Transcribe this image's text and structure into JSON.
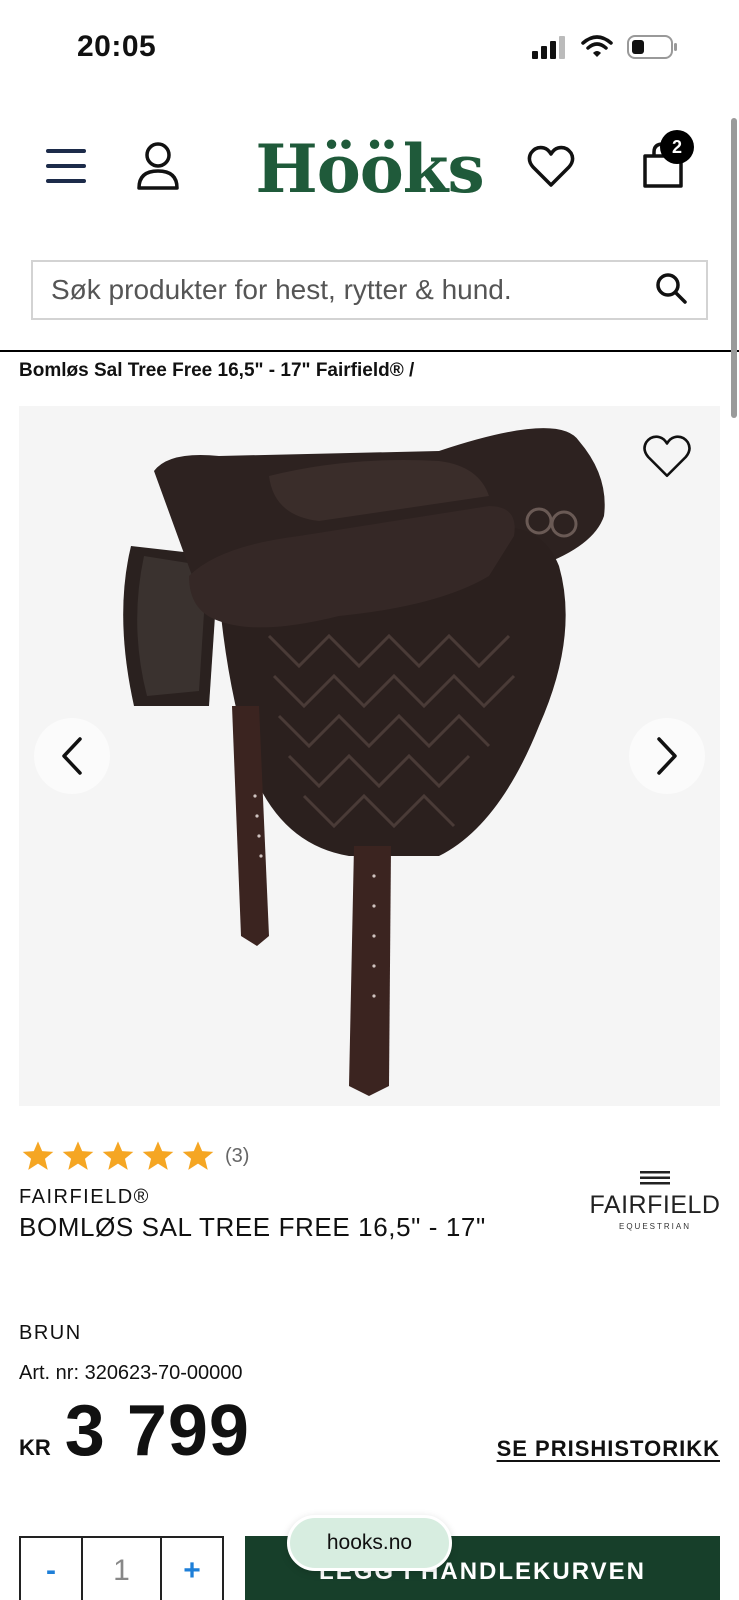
{
  "status_bar": {
    "time": "20:05"
  },
  "header": {
    "logo": "Hööks",
    "cart_count": "2"
  },
  "search": {
    "placeholder": "Søk produkter for hest, rytter & hund."
  },
  "breadcrumb": "Bomløs Sal Tree Free 16,5\" - 17\" Fairfield® /",
  "product": {
    "rating": {
      "stars": 5,
      "count": "(3)"
    },
    "brand": "FAIRFIELD®",
    "title": "BOMLØS SAL TREE FREE 16,5\" - 17\"",
    "brand_logo": {
      "name": "FAIRFIELD",
      "sub": "EQUESTRIAN"
    },
    "color": "BRUN",
    "art_nr": "Art. nr: 320623-70-00000",
    "currency": "KR",
    "price": "3 799",
    "price_history_link": "SE PRISHISTORIKK"
  },
  "cart_controls": {
    "minus": "-",
    "quantity": "1",
    "plus": "+",
    "add_to_cart": "LEGG I HANDLEKURVEN"
  },
  "browser": {
    "site": "hooks.no"
  },
  "colors": {
    "brand_green": "#1f5a3a",
    "button_green": "#173f2a",
    "star": "#f5a623",
    "qty_blue": "#1e7fd8"
  }
}
